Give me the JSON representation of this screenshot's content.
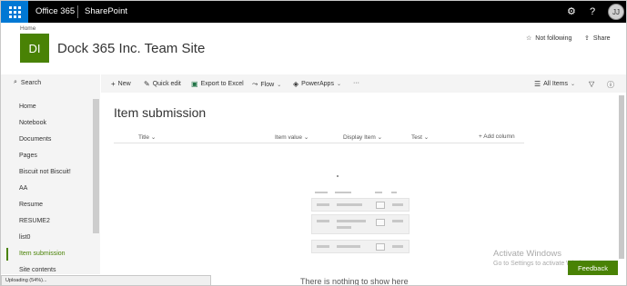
{
  "suite": {
    "brand": "Office 365",
    "app": "SharePoint",
    "settings_icon": "gear-icon",
    "help_icon": "question-icon",
    "user_initials": "JJ"
  },
  "site": {
    "breadcrumb": "Home",
    "logo_text": "DI",
    "logo_color": "#498205",
    "title": "Dock 365 Inc. Team Site",
    "follow_label": "Not following",
    "share_label": "Share"
  },
  "nav": {
    "search_label": "Search",
    "items": [
      "Home",
      "Notebook",
      "Documents",
      "Pages",
      "Biscuit not Biscuit!",
      "AA",
      "Resume",
      "RESUME2",
      "list0",
      "Item submission",
      "Site contents"
    ],
    "active": "Item submission"
  },
  "commands": {
    "new_label": "New",
    "quick_edit_label": "Quick edit",
    "export_label": "Export to Excel",
    "flow_label": "Flow",
    "powerapps_label": "PowerApps",
    "more_label": "···",
    "view_label": "All Items"
  },
  "list": {
    "title": "Item submission",
    "columns": [
      "Title",
      "Item value",
      "Display Item",
      "Test"
    ],
    "add_column_label": "+ Add column",
    "empty_text": "There is nothing to show here"
  },
  "overlay": {
    "watermark_title": "Activate Windows",
    "watermark_sub": "Go to Settings to activate Windows.",
    "feedback_label": "Feedback",
    "status_text": "Uploading (54%)..."
  },
  "colors": {
    "accent": "#498205",
    "suite_bar": "#000000",
    "waffle": "#0078d4"
  }
}
